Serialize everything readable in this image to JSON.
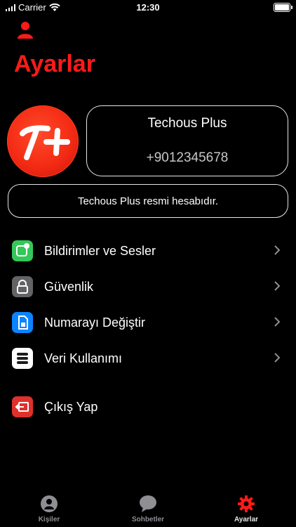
{
  "status_bar": {
    "carrier": "Carrier",
    "time": "12:30"
  },
  "page": {
    "title": "Ayarlar"
  },
  "profile": {
    "name": "Techous Plus",
    "phone": "+9012345678",
    "bio": "Techous Plus resmi hesabıdır."
  },
  "menu": [
    {
      "label": "Bildirimler ve Sesler",
      "icon": "notification-icon",
      "color": "#34c759"
    },
    {
      "label": "Güvenlik",
      "icon": "lock-icon",
      "color": "#636366"
    },
    {
      "label": "Numarayı Değiştir",
      "icon": "sim-card-icon",
      "color": "#0a84ff"
    },
    {
      "label": "Veri Kullanımı",
      "icon": "database-icon",
      "color": "#ffffff"
    }
  ],
  "logout": {
    "label": "Çıkış Yap",
    "icon": "logout-icon",
    "color": "#e0302c"
  },
  "tabs": [
    {
      "label": "Kişiler",
      "icon": "contacts-icon"
    },
    {
      "label": "Sohbetler",
      "icon": "chat-bubble-icon"
    },
    {
      "label": "Ayarlar",
      "icon": "gear-icon",
      "active": true
    }
  ],
  "colors": {
    "accent": "#ff1a1a",
    "background": "#000000",
    "avatar": "#f42b14"
  }
}
